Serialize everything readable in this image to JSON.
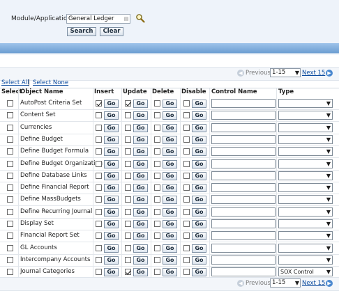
{
  "module": {
    "label": "Module/Application",
    "value": "General Ledger"
  },
  "buttons": {
    "search": "Search",
    "clear": "Clear",
    "go": "Go"
  },
  "nav": {
    "previous": "Previous",
    "range": "1-15",
    "next": "Next 15"
  },
  "links": {
    "select_all": "Select All",
    "select_none": "Select None"
  },
  "columns": [
    "Select",
    "Object Name",
    "Insert",
    "Update",
    "Delete",
    "Disable",
    "Control Name",
    "Type"
  ],
  "rows": [
    {
      "name": "AutoPost Criteria Set",
      "insert": true,
      "update": true,
      "delete": false,
      "disable": false,
      "type": ""
    },
    {
      "name": "Content Set",
      "insert": false,
      "update": false,
      "delete": false,
      "disable": false,
      "type": ""
    },
    {
      "name": "Currencies",
      "insert": false,
      "update": false,
      "delete": false,
      "disable": false,
      "type": ""
    },
    {
      "name": "Define Budget",
      "insert": false,
      "update": false,
      "delete": false,
      "disable": false,
      "type": ""
    },
    {
      "name": "Define Budget Formula",
      "insert": false,
      "update": false,
      "delete": false,
      "disable": false,
      "type": ""
    },
    {
      "name": "Define Budget Organization",
      "insert": false,
      "update": false,
      "delete": false,
      "disable": false,
      "type": ""
    },
    {
      "name": "Define Database Links",
      "insert": false,
      "update": false,
      "delete": false,
      "disable": false,
      "type": ""
    },
    {
      "name": "Define Financial Report",
      "insert": false,
      "update": false,
      "delete": false,
      "disable": false,
      "type": ""
    },
    {
      "name": "Define MassBudgets",
      "insert": false,
      "update": false,
      "delete": false,
      "disable": false,
      "type": ""
    },
    {
      "name": "Define Recurring Journal",
      "insert": false,
      "update": false,
      "delete": false,
      "disable": false,
      "type": ""
    },
    {
      "name": "Display Set",
      "insert": false,
      "update": false,
      "delete": false,
      "disable": false,
      "type": ""
    },
    {
      "name": "Financial Report Set",
      "insert": false,
      "update": false,
      "delete": false,
      "disable": false,
      "type": ""
    },
    {
      "name": "GL Accounts",
      "insert": false,
      "update": false,
      "delete": false,
      "disable": false,
      "type": ""
    },
    {
      "name": "Intercompany Accounts",
      "insert": false,
      "update": false,
      "delete": false,
      "disable": false,
      "type": ""
    },
    {
      "name": "Journal Categories",
      "insert": false,
      "update": true,
      "delete": false,
      "disable": false,
      "type": "SOX Control"
    }
  ]
}
